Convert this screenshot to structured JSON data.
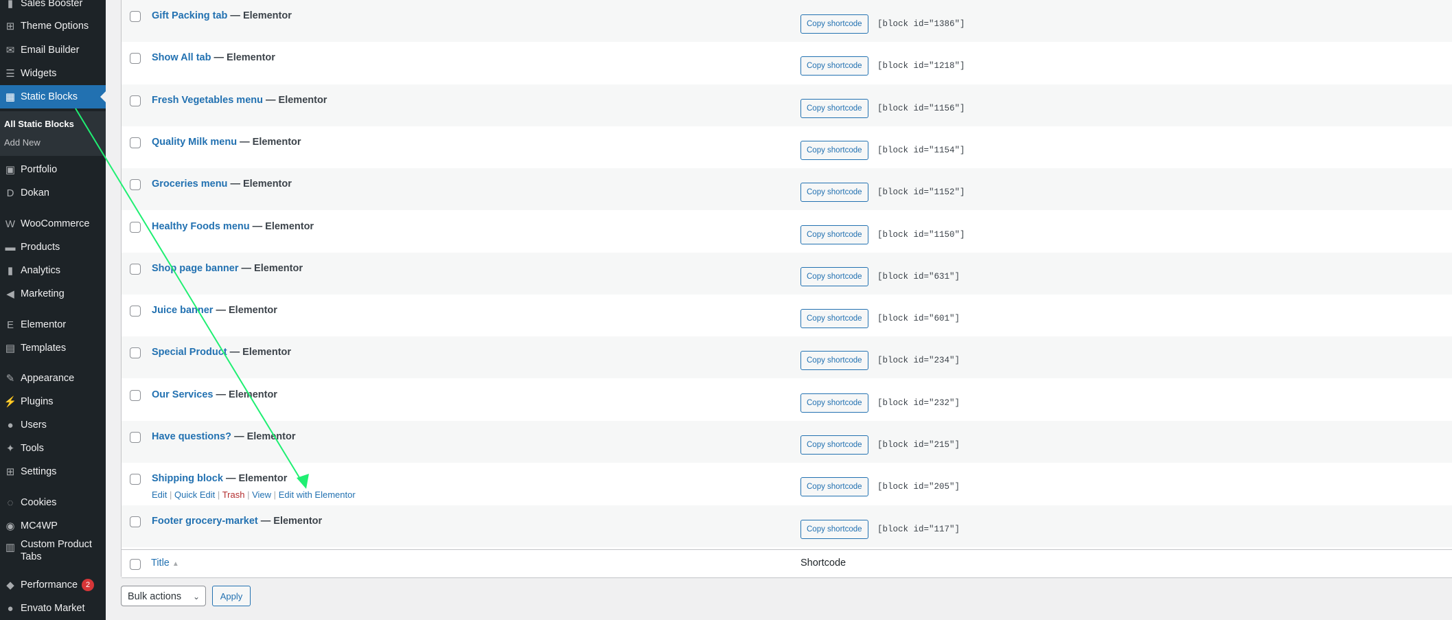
{
  "sidebar": {
    "items": [
      {
        "label": "Sales Booster",
        "icon": "bar-chart-icon"
      },
      {
        "label": "Theme Options",
        "icon": "sliders-icon"
      },
      {
        "label": "Email Builder",
        "icon": "envelope-icon"
      },
      {
        "label": "Widgets",
        "icon": "widgets-icon"
      },
      {
        "label": "Static Blocks",
        "icon": "table-icon",
        "active": true
      },
      {
        "label": "Portfolio",
        "icon": "images-icon"
      },
      {
        "label": "Dokan",
        "icon": "dokan-icon"
      },
      {
        "label": "WooCommerce",
        "icon": "woo-icon"
      },
      {
        "label": "Products",
        "icon": "archive-icon"
      },
      {
        "label": "Analytics",
        "icon": "bar-chart-icon"
      },
      {
        "label": "Marketing",
        "icon": "megaphone-icon"
      },
      {
        "label": "Elementor",
        "icon": "elementor-icon"
      },
      {
        "label": "Templates",
        "icon": "folder-icon"
      },
      {
        "label": "Appearance",
        "icon": "brush-icon"
      },
      {
        "label": "Plugins",
        "icon": "plug-icon"
      },
      {
        "label": "Users",
        "icon": "user-icon"
      },
      {
        "label": "Tools",
        "icon": "wrench-icon"
      },
      {
        "label": "Settings",
        "icon": "sliders-icon"
      },
      {
        "label": "Cookies",
        "icon": "cookie-icon"
      },
      {
        "label": "MC4WP",
        "icon": "mailchimp-icon"
      },
      {
        "label": "Custom Product Tabs",
        "icon": "layout-icon"
      },
      {
        "label": "Performance",
        "icon": "box-icon",
        "badge": "2"
      },
      {
        "label": "Envato Market",
        "icon": "leaf-icon"
      }
    ],
    "submenu": [
      {
        "label": "All Static Blocks",
        "current": true
      },
      {
        "label": "Add New"
      }
    ]
  },
  "table": {
    "copy_label": "Copy shortcode",
    "rows": [
      {
        "title": "Gift Packing tab",
        "suffix": "— Elementor",
        "shortcode": "[block id=\"1386\"]"
      },
      {
        "title": "Show All tab",
        "suffix": "— Elementor",
        "shortcode": "[block id=\"1218\"]"
      },
      {
        "title": "Fresh Vegetables menu",
        "suffix": "— Elementor",
        "shortcode": "[block id=\"1156\"]"
      },
      {
        "title": "Quality Milk menu",
        "suffix": "— Elementor",
        "shortcode": "[block id=\"1154\"]"
      },
      {
        "title": "Groceries menu",
        "suffix": "— Elementor",
        "shortcode": "[block id=\"1152\"]"
      },
      {
        "title": "Healthy Foods menu",
        "suffix": "— Elementor",
        "shortcode": "[block id=\"1150\"]"
      },
      {
        "title": "Shop page banner",
        "suffix": "— Elementor",
        "shortcode": "[block id=\"631\"]"
      },
      {
        "title": "Juice banner",
        "suffix": "— Elementor",
        "shortcode": "[block id=\"601\"]"
      },
      {
        "title": "Special Product",
        "suffix": "— Elementor",
        "shortcode": "[block id=\"234\"]"
      },
      {
        "title": "Our Services",
        "suffix": "— Elementor",
        "shortcode": "[block id=\"232\"]"
      },
      {
        "title": "Have questions?",
        "suffix": "— Elementor",
        "shortcode": "[block id=\"215\"]"
      },
      {
        "title": "Shipping block",
        "suffix": "— Elementor",
        "shortcode": "[block id=\"205\"]",
        "hover": true
      },
      {
        "title": "Footer grocery-market",
        "suffix": "— Elementor",
        "shortcode": "[block id=\"117\"]"
      }
    ],
    "row_actions": {
      "edit": "Edit",
      "quick_edit": "Quick Edit",
      "trash": "Trash",
      "view": "View",
      "edit_elementor": "Edit with Elementor"
    },
    "footer": {
      "title_col": "Title",
      "shortcode_col": "Shortcode"
    }
  },
  "bulk": {
    "selected": "Bulk actions",
    "apply": "Apply"
  },
  "colors": {
    "accent": "#2271b1",
    "sidebar_bg": "#1d2327",
    "annotation": "#1fef72",
    "trash": "#b32d2e"
  }
}
